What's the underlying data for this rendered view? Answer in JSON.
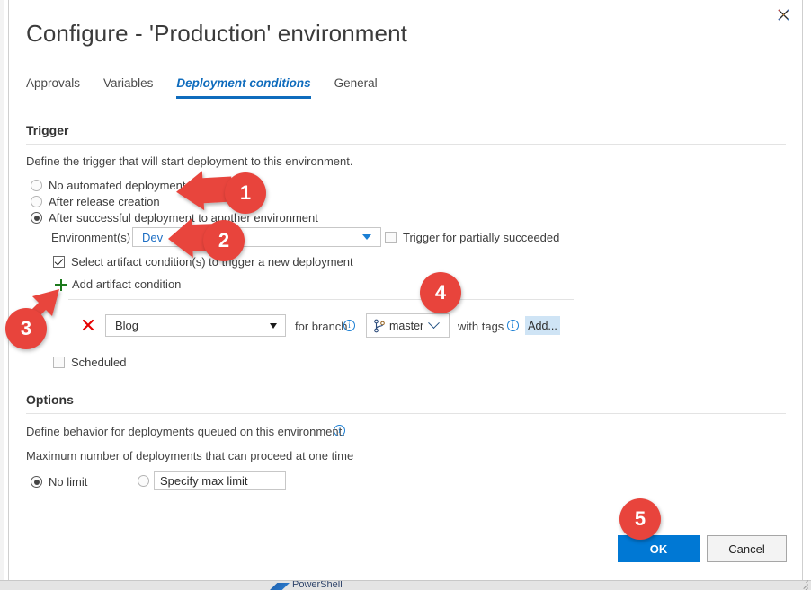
{
  "window": {
    "close_icon": "close-icon",
    "resize_grip_icon": "resize-grip-icon"
  },
  "dialog": {
    "title": "Configure - 'Production' environment"
  },
  "tabs": [
    {
      "label": "Approvals",
      "active": false
    },
    {
      "label": "Variables",
      "active": false
    },
    {
      "label": "Deployment conditions",
      "active": true
    },
    {
      "label": "General",
      "active": false
    }
  ],
  "trigger": {
    "heading": "Trigger",
    "description": "Define the trigger that will start deployment to this environment.",
    "options": [
      {
        "label": "No automated deployment",
        "checked": false
      },
      {
        "label": "After release creation",
        "checked": false
      },
      {
        "label": "After successful deployment to another environment",
        "checked": true
      }
    ],
    "environments_label": "Environment(s)",
    "environments_value": "Dev",
    "partially_succeeded_label": "Trigger for partially succeeded",
    "partially_succeeded_checked": false,
    "artifact_conditions_label": "Select artifact condition(s) to trigger a new deployment",
    "artifact_conditions_checked": true,
    "add_artifact_condition_label": "Add artifact condition",
    "artifact_rows": [
      {
        "delete_icon": "delete-x-icon",
        "artifact": "Blog",
        "for_branch_label": "for branch",
        "for_branch_info_icon": "info-icon",
        "branch_icon": "git-branch-icon",
        "branch": "master",
        "with_tags_label": "with tags",
        "with_tags_info_icon": "info-icon",
        "add_tag_label": "Add..."
      }
    ],
    "scheduled_label": "Scheduled",
    "scheduled_checked": false
  },
  "options": {
    "heading": "Options",
    "description": "Define behavior for deployments queued on this environment.",
    "description_info_icon": "info-icon",
    "max_deployments_label": "Maximum number of deployments that can proceed at one time",
    "no_limit_label": "No limit",
    "no_limit_checked": true,
    "specify_limit_checked": false,
    "specify_limit_placeholder": "Specify max limit",
    "specify_limit_value": ""
  },
  "footer": {
    "ok_label": "OK",
    "cancel_label": "Cancel"
  },
  "annotations": [
    {
      "number": "1"
    },
    {
      "number": "2"
    },
    {
      "number": "3"
    },
    {
      "number": "4"
    },
    {
      "number": "5"
    }
  ],
  "taskbar": {
    "label": "PowerShell"
  },
  "colors": {
    "accent": "#0078d4",
    "tab_active": "#0f6cbd",
    "annotation_red": "#e8443c",
    "plus_green": "#1d7a1d",
    "delete_red": "#e60000",
    "tag_button_bg": "#cfe4f5"
  }
}
